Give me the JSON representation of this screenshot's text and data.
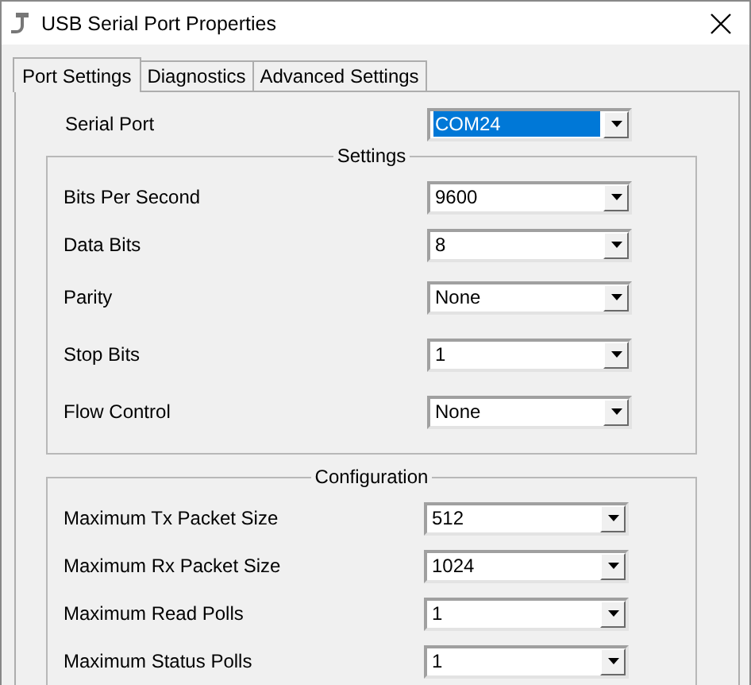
{
  "window": {
    "title": "USB Serial Port Properties"
  },
  "tabs": [
    {
      "label": "Port Settings",
      "selected": true
    },
    {
      "label": "Diagnostics",
      "selected": false
    },
    {
      "label": "Advanced Settings",
      "selected": false
    }
  ],
  "serial_port": {
    "label": "Serial Port",
    "value": "COM24",
    "highlighted": true
  },
  "groups": [
    {
      "title": "Settings",
      "rows": [
        {
          "label": "Bits Per Second",
          "value": "9600"
        },
        {
          "label": "Data Bits",
          "value": "8"
        },
        {
          "label": "Parity",
          "value": "None"
        },
        {
          "label": "Stop Bits",
          "value": "1"
        },
        {
          "label": "Flow Control",
          "value": "None"
        }
      ]
    },
    {
      "title": "Configuration",
      "rows": [
        {
          "label": "Maximum Tx Packet Size",
          "value": "512"
        },
        {
          "label": "Maximum Rx Packet Size",
          "value": "1024"
        },
        {
          "label": "Maximum Read Polls",
          "value": "1"
        },
        {
          "label": "Maximum Status Polls",
          "value": "1"
        }
      ]
    }
  ]
}
